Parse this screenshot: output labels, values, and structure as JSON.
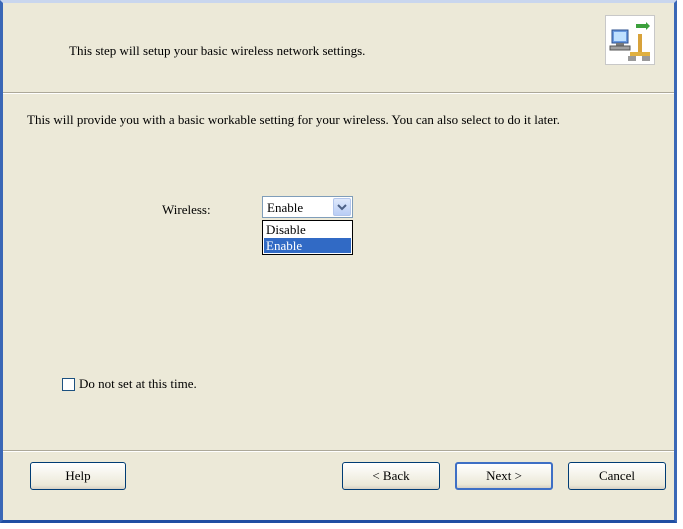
{
  "header": {
    "text": "This step will setup your basic wireless network settings.",
    "icon": "network-wizard-icon"
  },
  "description": "This will provide you with a basic workable setting for your wireless. You can also select to do it later.",
  "wireless": {
    "label": "Wireless:",
    "selected": "Enable",
    "options": [
      "Disable",
      "Enable"
    ]
  },
  "checkbox": {
    "label": "Do not set at this time.",
    "checked": false
  },
  "buttons": {
    "help": "Help",
    "back": "< Back",
    "next": "Next >",
    "cancel": "Cancel"
  },
  "colors": {
    "dialog_bg": "#ece9d8",
    "border": "#3a67b6",
    "selection": "#316ac5"
  }
}
